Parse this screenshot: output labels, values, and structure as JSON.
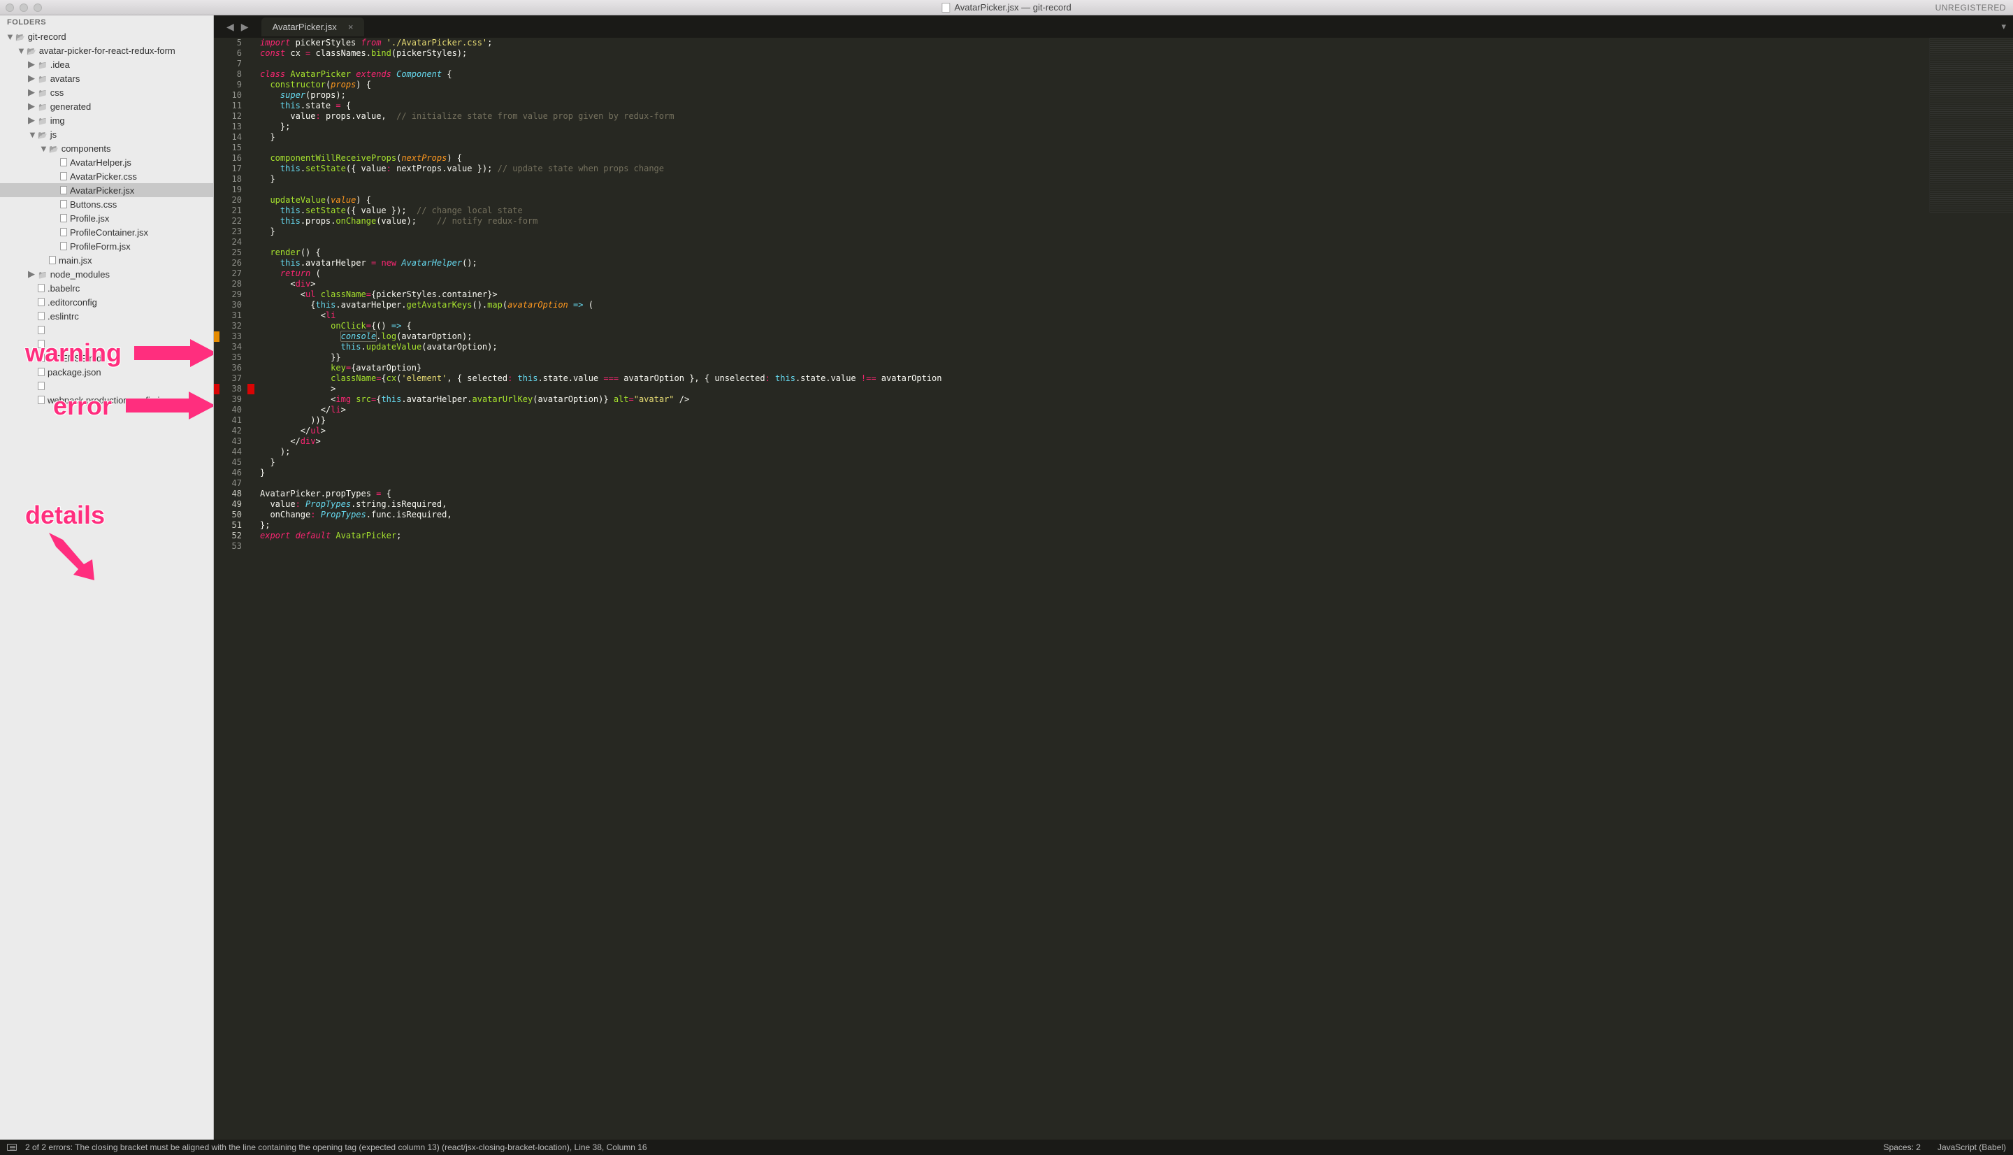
{
  "titlebar": {
    "title": "AvatarPicker.jsx — git-record",
    "unregistered": "UNREGISTERED"
  },
  "sidebar": {
    "header": "FOLDERS",
    "tree": [
      {
        "depth": 0,
        "twisty": "▼",
        "icon": "folder-open",
        "label": "git-record",
        "interact": true
      },
      {
        "depth": 1,
        "twisty": "▼",
        "icon": "folder-open",
        "label": "avatar-picker-for-react-redux-form",
        "interact": true
      },
      {
        "depth": 2,
        "twisty": "▶",
        "icon": "folder",
        "label": ".idea",
        "interact": true
      },
      {
        "depth": 2,
        "twisty": "▶",
        "icon": "folder",
        "label": "avatars",
        "interact": true
      },
      {
        "depth": 2,
        "twisty": "▶",
        "icon": "folder",
        "label": "css",
        "interact": true
      },
      {
        "depth": 2,
        "twisty": "▶",
        "icon": "folder",
        "label": "generated",
        "interact": true
      },
      {
        "depth": 2,
        "twisty": "▶",
        "icon": "folder",
        "label": "img",
        "interact": true
      },
      {
        "depth": 2,
        "twisty": "▼",
        "icon": "folder-open",
        "label": "js",
        "interact": true
      },
      {
        "depth": 3,
        "twisty": "▼",
        "icon": "folder-open",
        "label": "components",
        "interact": true
      },
      {
        "depth": 4,
        "twisty": "",
        "icon": "file",
        "label": "AvatarHelper.js",
        "interact": true
      },
      {
        "depth": 4,
        "twisty": "",
        "icon": "file",
        "label": "AvatarPicker.css",
        "interact": true
      },
      {
        "depth": 4,
        "twisty": "",
        "icon": "file",
        "label": "AvatarPicker.jsx",
        "interact": true,
        "selected": true
      },
      {
        "depth": 4,
        "twisty": "",
        "icon": "file",
        "label": "Buttons.css",
        "interact": true
      },
      {
        "depth": 4,
        "twisty": "",
        "icon": "file",
        "label": "Profile.jsx",
        "interact": true
      },
      {
        "depth": 4,
        "twisty": "",
        "icon": "file",
        "label": "ProfileContainer.jsx",
        "interact": true
      },
      {
        "depth": 4,
        "twisty": "",
        "icon": "file",
        "label": "ProfileForm.jsx",
        "interact": true
      },
      {
        "depth": 3,
        "twisty": "",
        "icon": "file",
        "label": "main.jsx",
        "interact": true
      },
      {
        "depth": 2,
        "twisty": "▶",
        "icon": "folder",
        "label": "node_modules",
        "interact": true
      },
      {
        "depth": 2,
        "twisty": "",
        "icon": "file",
        "label": ".babelrc",
        "interact": true
      },
      {
        "depth": 2,
        "twisty": "",
        "icon": "file",
        "label": ".editorconfig",
        "interact": true
      },
      {
        "depth": 2,
        "twisty": "",
        "icon": "file",
        "label": ".eslintrc",
        "interact": true
      },
      {
        "depth": 2,
        "twisty": "",
        "icon": "file",
        "label": "",
        "interact": true,
        "obscured": true
      },
      {
        "depth": 2,
        "twisty": "",
        "icon": "file",
        "label": "",
        "interact": true,
        "obscured": true
      },
      {
        "depth": 2,
        "twisty": "",
        "icon": "file",
        "label": "LICENSE.md",
        "interact": true
      },
      {
        "depth": 2,
        "twisty": "",
        "icon": "file",
        "label": "package.json",
        "interact": true
      },
      {
        "depth": 2,
        "twisty": "",
        "icon": "file",
        "label": "",
        "interact": true,
        "obscured": true
      },
      {
        "depth": 2,
        "twisty": "",
        "icon": "file",
        "label": "webpack.production.config.js",
        "interact": true,
        "obscured_partial": true
      }
    ]
  },
  "annotations": {
    "warning": "warning",
    "error": "error",
    "details": "details"
  },
  "tab": {
    "name": "AvatarPicker.jsx"
  },
  "gutter": {
    "start": 5,
    "end": 53,
    "warnings": [
      33
    ],
    "errors": [
      38
    ],
    "highlight": [
      48,
      49,
      50,
      51,
      52
    ]
  },
  "code_lines": [
    "<span class='ki'>import</span> pickerStyles <span class='ki'>from</span> <span class='s'>'./AvatarPicker.css'</span>;",
    "<span class='ki'>const</span> <span class='w'>cx</span> <span class='o'>=</span> classNames.<span class='f'>bind</span>(pickerStyles);",
    "",
    "<span class='ki'>class</span> <span class='f'>AvatarPicker</span> <span class='ki'>extends</span> <span class='t'>Component</span> {",
    "  <span class='f'>constructor</span>(<span class='p'>props</span>) {",
    "    <span class='t'>super</span>(props);",
    "    <span class='cn'>this</span>.state <span class='o'>=</span> {",
    "      value<span class='o'>:</span> props.value,  <span class='c'>// initialize state from value prop given by redux-form</span>",
    "    };",
    "  }",
    "",
    "  <span class='f'>componentWillReceiveProps</span>(<span class='p'>nextProps</span>) {",
    "    <span class='cn'>this</span>.<span class='f'>setState</span>({ value<span class='o'>:</span> nextProps.value }); <span class='c'>// update state when props change</span>",
    "  }",
    "",
    "  <span class='f'>updateValue</span>(<span class='p'>value</span>) {",
    "    <span class='cn'>this</span>.<span class='f'>setState</span>({ value });  <span class='c'>// change local state</span>",
    "    <span class='cn'>this</span>.props.<span class='f'>onChange</span>(value);    <span class='c'>// notify redux-form</span>",
    "  }",
    "",
    "  <span class='f'>render</span>() {",
    "    <span class='cn'>this</span>.avatarHelper <span class='o'>=</span> <span class='o'>new</span> <span class='t'>AvatarHelper</span>();",
    "    <span class='ki'>return</span> (",
    "      &lt;<span class='k'>div</span>&gt;",
    "        &lt;<span class='k'>ul</span> <span class='f'>className</span><span class='o'>=</span>{pickerStyles.container}&gt;",
    "          {<span class='cn'>this</span>.avatarHelper.<span class='f'>getAvatarKeys</span>().<span class='f'>map</span>(<span class='p'>avatarOption</span> <span class='t'>=&gt;</span> (",
    "            &lt;<span class='k'>li</span>",
    "              <span class='f'>onClick</span><span class='o'>=</span>{() <span class='t'>=&gt;</span> {",
    "                <span class='box'><span class='t'>console</span></span>.<span class='f'>log</span>(avatarOption);",
    "                <span class='cn'>this</span>.<span class='f'>updateValue</span>(avatarOption);",
    "              }}",
    "              <span class='f'>key</span><span class='o'>=</span>{avatarOption}",
    "              <span class='f'>className</span><span class='o'>=</span>{<span class='f'>cx</span>(<span class='s'>'element'</span>, { selected<span class='o'>:</span> <span class='cn'>this</span>.state.value <span class='o'>===</span> avatarOption }, { unselected<span class='o'>:</span> <span class='cn'>this</span>.state.value <span class='o'>!==</span> avatarOption",
    "              &gt;",
    "              &lt;<span class='k'>img</span> <span class='f'>src</span><span class='o'>=</span>{<span class='cn'>this</span>.avatarHelper.<span class='f'>avatarUrlKey</span>(avatarOption)} <span class='f'>alt</span><span class='o'>=</span><span class='s'>\"avatar\"</span> /&gt;",
    "            &lt;/<span class='k'>li</span>&gt;",
    "          ))}",
    "        &lt;/<span class='k'>ul</span>&gt;",
    "      &lt;/<span class='k'>div</span>&gt;",
    "    );",
    "  }",
    "}",
    "",
    "AvatarPicker.propTypes <span class='o'>=</span> {",
    "  value<span class='o'>:</span> <span class='t'>PropTypes</span>.string.isRequired,",
    "  onChange<span class='o'>:</span> <span class='t'>PropTypes</span>.func.isRequired,",
    "};",
    "<span class='ki'>export</span> <span class='ki'>default</span> <span class='f'>AvatarPicker</span>;",
    ""
  ],
  "statusbar": {
    "message": "2 of 2 errors: The closing bracket must be aligned with the line containing the opening tag (expected column 13) (react/jsx-closing-bracket-location), Line 38, Column 16",
    "spaces": "Spaces: 2",
    "syntax": "JavaScript (Babel)"
  }
}
